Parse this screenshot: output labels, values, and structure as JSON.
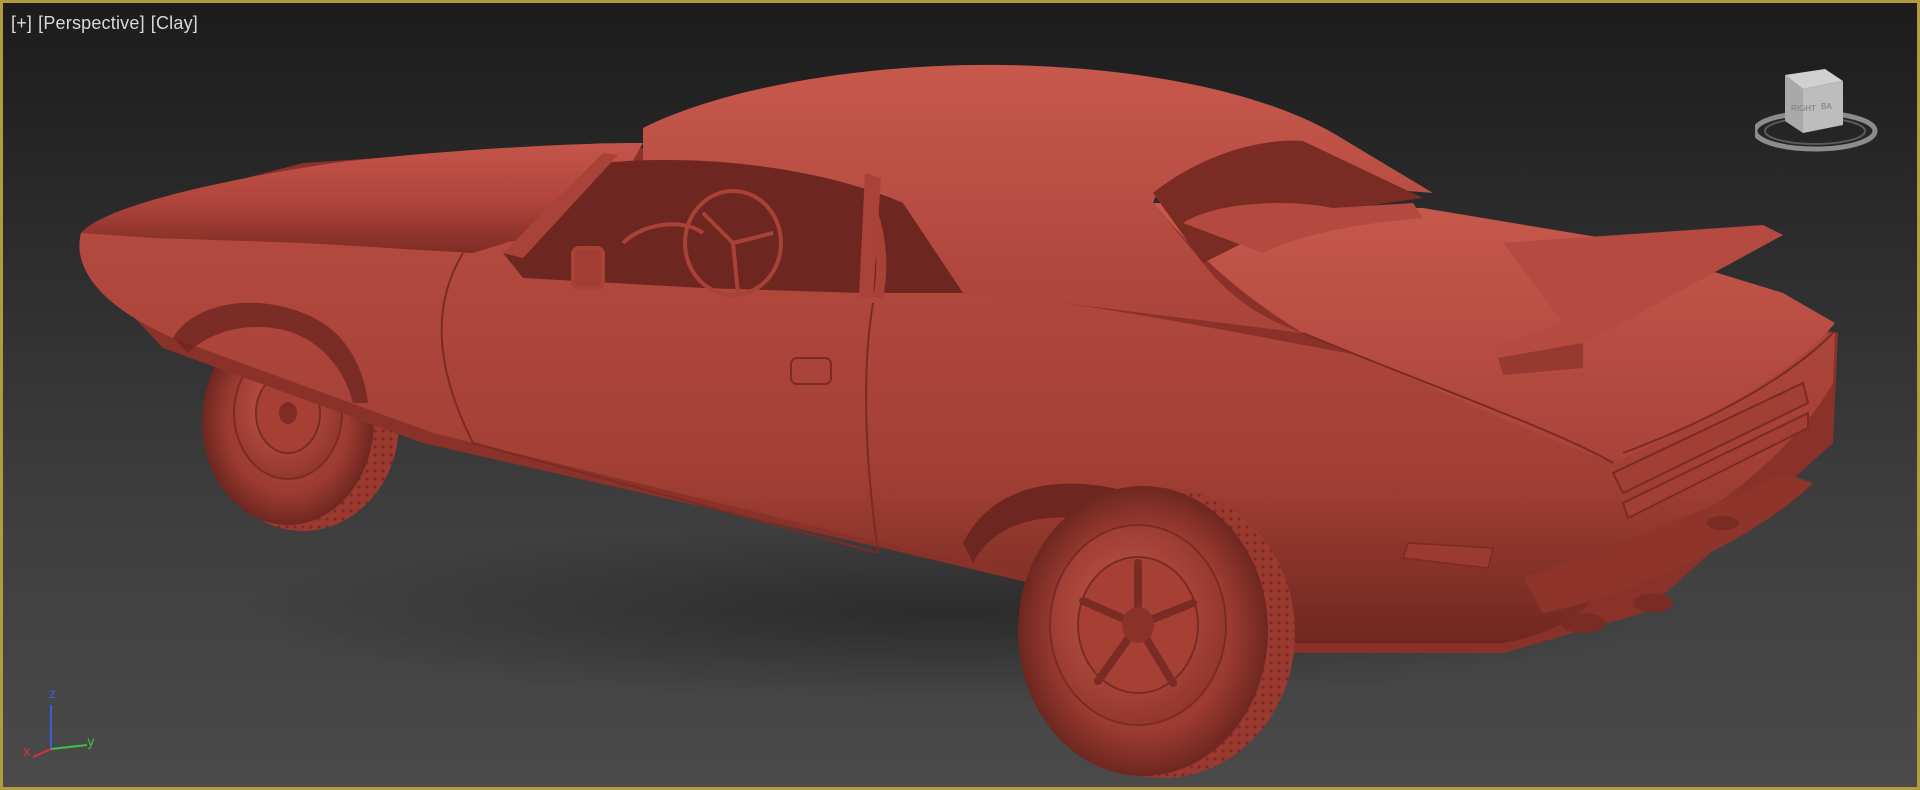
{
  "viewport": {
    "labels": {
      "plus": "+",
      "view": "Perspective",
      "shading": "Clay"
    },
    "border_color": "#b39a3c",
    "model_color": "#b5463b",
    "model_name": "muscle-car-clay-model"
  },
  "viewcube": {
    "face_text_left": "RIGHT",
    "face_text_right": "BA"
  },
  "axis_tripod": {
    "z": "z",
    "x": "x",
    "y": "y",
    "colors": {
      "x": "#d8333a",
      "y": "#3dbf4a",
      "z": "#3a5ed8"
    }
  }
}
